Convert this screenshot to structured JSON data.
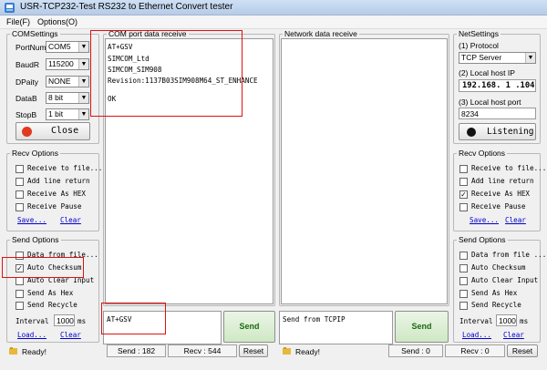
{
  "window": {
    "title": "USR-TCP232-Test  RS232 to Ethernet Convert tester"
  },
  "menu": [
    "File(F)",
    "Options(O)"
  ],
  "com_settings": {
    "legend": "COMSettings",
    "port": {
      "label": "PortNum",
      "value": "COM5"
    },
    "baud": {
      "label": "BaudR",
      "value": "115200"
    },
    "parity": {
      "label": "DPaity",
      "value": "NONE"
    },
    "databits": {
      "label": "DataB",
      "value": "8 bit"
    },
    "stopbits": {
      "label": "StopB",
      "value": "1 bit"
    },
    "close_label": "Close"
  },
  "left_recv": {
    "legend": "Recv Options",
    "options": [
      "Receive to file...",
      "Add line return",
      "Receive As HEX",
      "Receive Pause"
    ],
    "checked": [
      false,
      false,
      false,
      false
    ],
    "save": "Save...",
    "clear": "Clear"
  },
  "left_send": {
    "legend": "Send Options",
    "options": [
      "Data from file...",
      "Auto Checksum",
      "Auto Clear Input",
      "Send As Hex",
      "Send Recycle"
    ],
    "checked": [
      false,
      true,
      false,
      false,
      false
    ],
    "interval_label": "Interval",
    "interval_value": "1000",
    "interval_unit": "ms",
    "load": "Load...",
    "clear": "Clear"
  },
  "com_receive": {
    "legend": "COM port data receive",
    "lines": [
      "AT+GSV",
      "SIMCOM_Ltd",
      "SIMCOM_SIM908",
      "Revision:1137B03SIM908M64_ST_ENHANCE",
      "",
      "OK"
    ]
  },
  "net_receive": {
    "legend": "Network data receive"
  },
  "com_send": {
    "text": "AT+GSV",
    "send_label": "Send"
  },
  "net_send": {
    "text": "Send from TCPIP",
    "send_label": "Send"
  },
  "net_settings": {
    "legend": "NetSettings",
    "protocol_label": "(1) Protocol",
    "protocol_value": "TCP Server",
    "host_ip_label": "(2) Local host IP",
    "host_ip_value": "192.168. 1 .104",
    "host_port_label": "(3) Local host port",
    "host_port_value": "8234",
    "listen_label": "Listening"
  },
  "right_recv": {
    "legend": "Recv Options",
    "options": [
      "Receive to file...",
      "Add line return",
      "Receive As HEX",
      "Receive Pause"
    ],
    "checked": [
      false,
      false,
      true,
      false
    ],
    "save": "Save...",
    "clear": "Clear"
  },
  "right_send": {
    "legend": "Send Options",
    "options": [
      "Data from file ...",
      "Auto Checksum",
      "Auto Clear Input",
      "Send As Hex",
      "Send Recycle"
    ],
    "checked": [
      false,
      false,
      false,
      false,
      false
    ],
    "interval_label": "Interval",
    "interval_value": "1000",
    "interval_unit": "ms",
    "load": "Load...",
    "clear": "Clear"
  },
  "status_left": {
    "ready": "Ready!",
    "send": "Send : 182",
    "recv": "Recv : 544",
    "reset": "Reset"
  },
  "status_right": {
    "ready": "Ready!",
    "send": "Send : 0",
    "recv": "Recv : 0",
    "reset": "Reset"
  }
}
